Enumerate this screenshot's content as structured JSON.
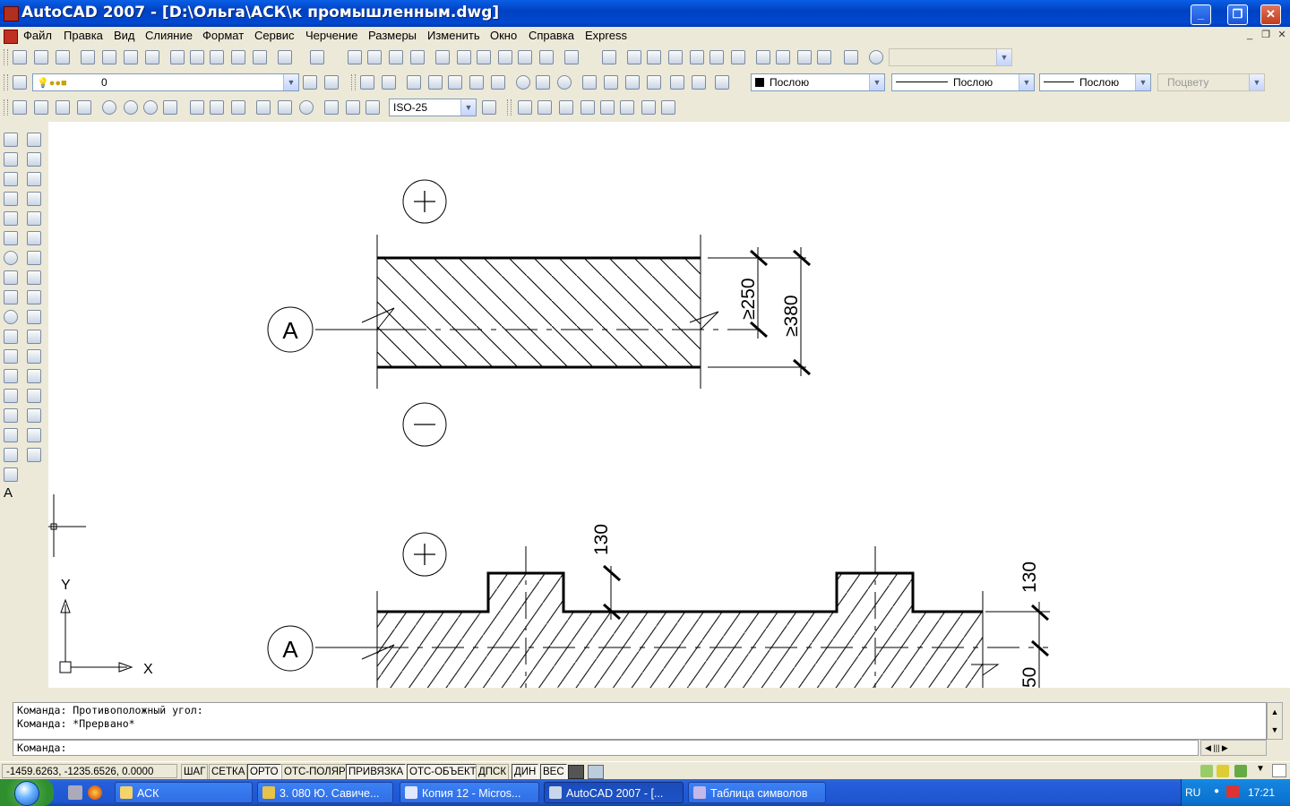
{
  "window": {
    "title": "AutoCAD 2007 - [D:\\Ольга\\АСК\\к промышленным.dwg]"
  },
  "menu": [
    "Файл",
    "Правка",
    "Вид",
    "Слияние",
    "Формат",
    "Сервис",
    "Черчение",
    "Размеры",
    "Изменить",
    "Окно",
    "Справка",
    "Express"
  ],
  "toolbar2": {
    "layer_value": "0",
    "color_value": "Послою",
    "linetype_value": "Послою",
    "lineweight_value": "Послою",
    "plotstyle_value": "Поцвету"
  },
  "toolbar3": {
    "dimstyle_value": "ISO-25"
  },
  "drawing": {
    "axis_a_top": "A",
    "axis_a_bottom": "A",
    "dim_250": "≥250",
    "dim_380": "≥380",
    "dim_130_left": "130",
    "dim_130_right": "130",
    "dim_partial": "50",
    "ucs_y": "Y",
    "ucs_x": "X"
  },
  "command": {
    "history": [
      "Команда: Противоположный угол:",
      "Команда: *Прервано*"
    ],
    "prompt": "Команда:"
  },
  "status": {
    "coords": "-1459.6263, -1235.6526, 0.0000",
    "buttons": [
      "ШАГ",
      "СЕТКА",
      "ОРТО",
      "ОТС-ПОЛЯР",
      "ПРИВЯЗКА",
      "ОТС-ОБЪЕКТ",
      "ДПСК",
      "ДИН",
      "ВЕС"
    ]
  },
  "taskbar": {
    "items": [
      "АСК",
      "3. 080 Ю. Савиче...",
      "Копия 12 - Micros...",
      "AutoCAD 2007 - [...",
      "Таблица символов"
    ],
    "lang": "RU",
    "clock": "17:21"
  }
}
